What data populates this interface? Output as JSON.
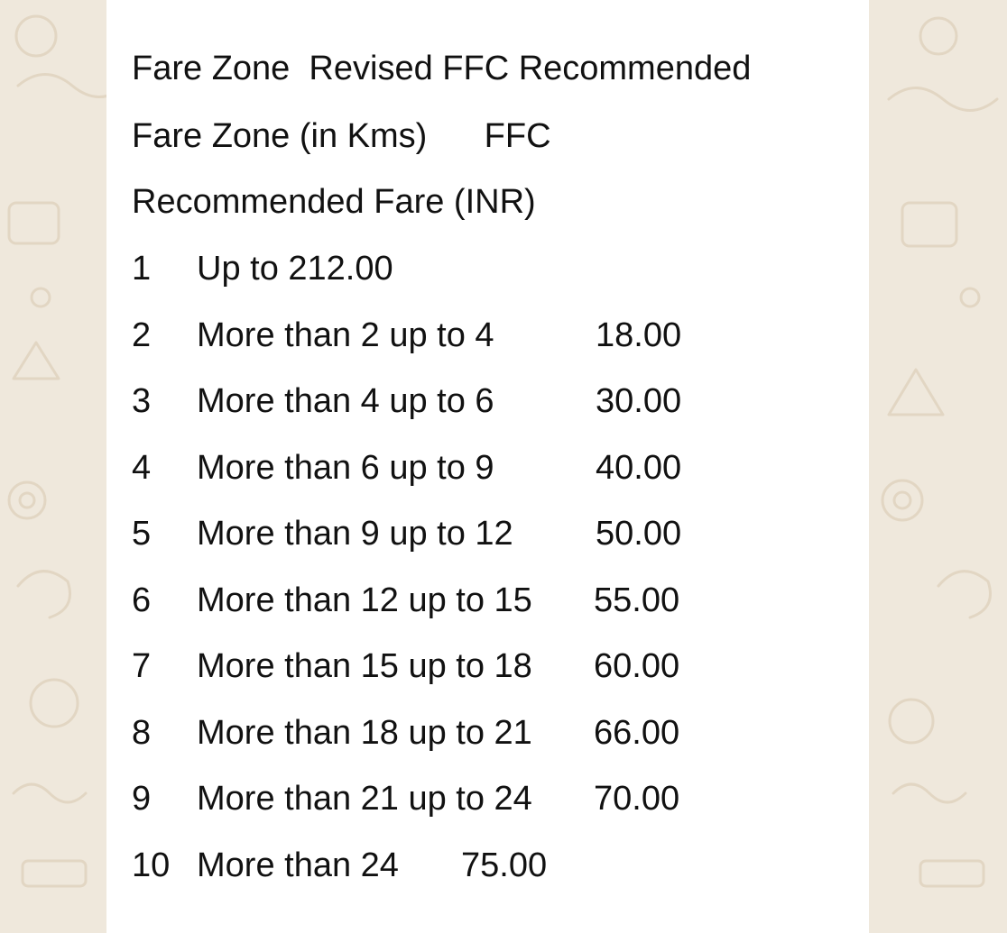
{
  "message": {
    "header_lines": [
      "Fare Zone  Revised FFC Recommended",
      "Fare Zone (in Kms)      FFC",
      "Recommended Fare (INR)"
    ],
    "rows": [
      {
        "zone": "1",
        "range": "Up to 212.00",
        "fare": ""
      },
      {
        "zone": "2",
        "range": "More than 2 up to 4",
        "fare": "18.00"
      },
      {
        "zone": "3",
        "range": "More than 4 up to 6",
        "fare": "30.00"
      },
      {
        "zone": "4",
        "range": "More than 6 up to 9",
        "fare": "40.00"
      },
      {
        "zone": "5",
        "range": "More than 9 up to 12",
        "fare": "50.00"
      },
      {
        "zone": "6",
        "range": "More than 12 up to 15",
        "fare": "55.00"
      },
      {
        "zone": "7",
        "range": "More than 15 up to 18",
        "fare": "60.00"
      },
      {
        "zone": "8",
        "range": "More than 18 up to 21",
        "fare": "66.00"
      },
      {
        "zone": "9",
        "range": "More than 21 up to 24",
        "fare": "70.00"
      },
      {
        "zone": "10",
        "range": "More than 24",
        "fare": "75.00"
      }
    ]
  },
  "colors": {
    "wallpaper": "#efe8dc",
    "doodle": "#e2d6c3",
    "bubble": "#ffffff",
    "text": "#111111"
  }
}
